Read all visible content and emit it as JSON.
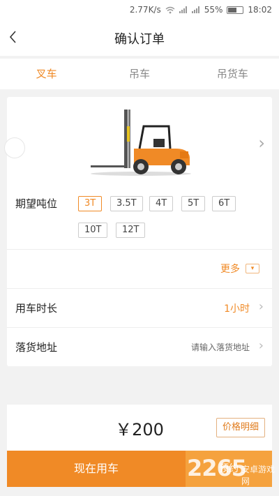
{
  "status_bar": {
    "speed": "2.77K/s",
    "battery": "55%",
    "time": "18:02"
  },
  "nav": {
    "title": "确认订单",
    "back_icon": "chevron-left-icon"
  },
  "tabs": [
    {
      "label": "叉车",
      "active": true
    },
    {
      "label": "吊车",
      "active": false
    },
    {
      "label": "吊货车",
      "active": false
    }
  ],
  "vehicle": {
    "image": "forklift-illustration"
  },
  "tonnage": {
    "label": "期望吨位",
    "options": [
      "3T",
      "3.5T",
      "4T",
      "5T",
      "6T",
      "10T",
      "12T"
    ],
    "selected": "3T"
  },
  "more": {
    "label": "更多"
  },
  "duration": {
    "label": "用车时长",
    "value": "1小时"
  },
  "address": {
    "label": "落货地址",
    "placeholder": "请输入落货地址"
  },
  "price": {
    "amount": "￥200",
    "detail_label": "价格明细"
  },
  "actions": {
    "order_now": "现在用车",
    "order_later": "预约"
  },
  "watermark": {
    "number": "2265",
    "text": "安卓游戏网"
  },
  "colors": {
    "accent": "#f08a26",
    "accent_light": "#f5a23e"
  }
}
